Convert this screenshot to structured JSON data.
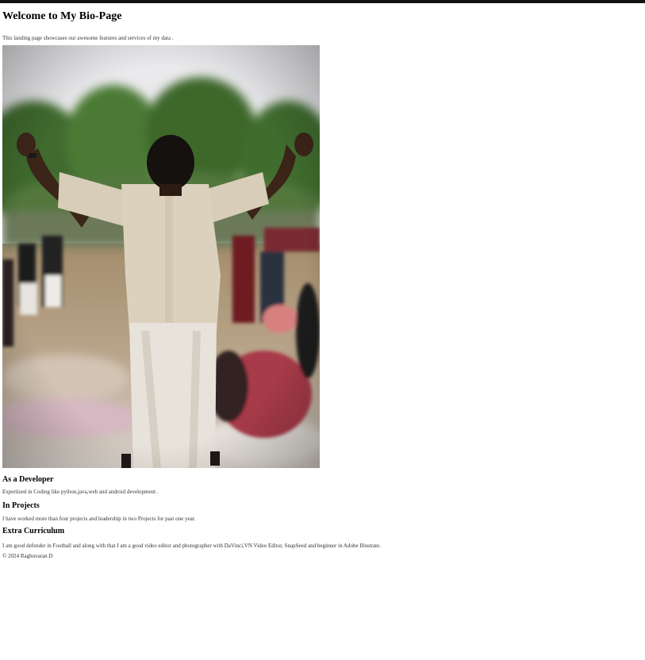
{
  "header": {
    "title": "Welcome to My Bio-Page",
    "intro": "This landing page showcases our awesome features and services of my data ."
  },
  "hero_image": {
    "description": "Person in white shirt and dhoti seen from behind with arms raised, blurred crowd and trees in background"
  },
  "sections": [
    {
      "heading": "As a Developer",
      "text": "Expertized in Coding like python,java,web and android development ."
    },
    {
      "heading": "In Projects",
      "text": "I have worked more than four projects and leadership in two Projects for past one year."
    },
    {
      "heading": "Extra Curriculum",
      "text": "I am good defender in Football and along with that I am a good video editor and photographer with DaVinci,VN Video Editor, SnapSeed and beginner in Adobe Illustrate."
    }
  ],
  "footer": {
    "copyright": "© 2024 Raghuvaran D"
  }
}
